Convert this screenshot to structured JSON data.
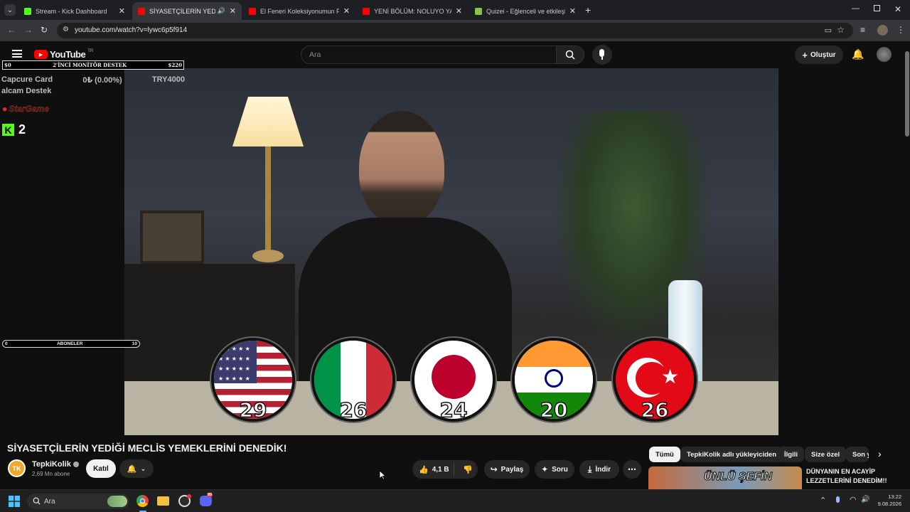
{
  "browser": {
    "tabs": [
      {
        "title": "Stream - Kick Dashboard",
        "active": false,
        "favicon_color": "#53fc18"
      },
      {
        "title": "SİYASETÇİLERİN YEDİĞİ ME",
        "active": true,
        "favicon_color": "#ff0000"
      },
      {
        "title": "El Feneri Koleksiyonumun Favo",
        "active": false,
        "favicon_color": "#ff0000"
      },
      {
        "title": "YENİ BÖLÜM: NOLUYO YA ¿ VS",
        "active": false,
        "favicon_color": "#ff0000"
      },
      {
        "title": "Quizei - Eğlenceli ve etkileşimli",
        "active": false,
        "favicon_color": "#8bc34a"
      }
    ],
    "url": "youtube.com/watch?v=lywc6p5f914"
  },
  "youtube": {
    "logo_text": "YouTube",
    "region": "TR",
    "search_placeholder": "Ara",
    "create_label": "Oluştur"
  },
  "overlay": {
    "goal_bar": {
      "left": "$0",
      "title": "2'İNCİ MONİTÖR DESTEK",
      "right": "$220"
    },
    "capture_label": "Capcure Card",
    "capture_value": "0₺ (0.00%)",
    "capture_target": "TRY4000",
    "capture_sub": "alcam Destek",
    "brand": "StarGame",
    "kick_count": "2",
    "subs_bar": {
      "left": "0",
      "title": "ABONELER",
      "right": "10"
    }
  },
  "video": {
    "flags": [
      {
        "country": "usa-flag-icon",
        "score": "29"
      },
      {
        "country": "italy-flag-icon",
        "score": "26"
      },
      {
        "country": "japan-flag-icon",
        "score": "24"
      },
      {
        "country": "india-flag-icon",
        "score": "20"
      },
      {
        "country": "turkey-flag-icon",
        "score": "26"
      }
    ]
  },
  "details": {
    "title": "SİYASETÇİLERİN YEDİĞİ MECLİS YEMEKLERİNİ DENEDİK!",
    "channel": "TepkiKolik",
    "channel_initials": "TK",
    "subscribers": "2,69 Mn abone",
    "join_label": "Katıl",
    "likes": "4,1 B",
    "share_label": "Paylaş",
    "ask_label": "Soru",
    "download_label": "İndir"
  },
  "chips": [
    "Tümü",
    "TepkiKolik adlı yükleyiciden",
    "İlgili",
    "Size özel",
    "Son y"
  ],
  "suggestion": {
    "title_line1": "DÜNYANIN EN ACAYİP",
    "title_line2": "LEZZETLERİNİ DENEDİM!!",
    "thumb_text": "ÜNLÜ ŞEFİN"
  },
  "taskbar": {
    "search_placeholder": "Ara",
    "time": "13:22",
    "date": "9.08.2026",
    "discord_badge": "99"
  }
}
